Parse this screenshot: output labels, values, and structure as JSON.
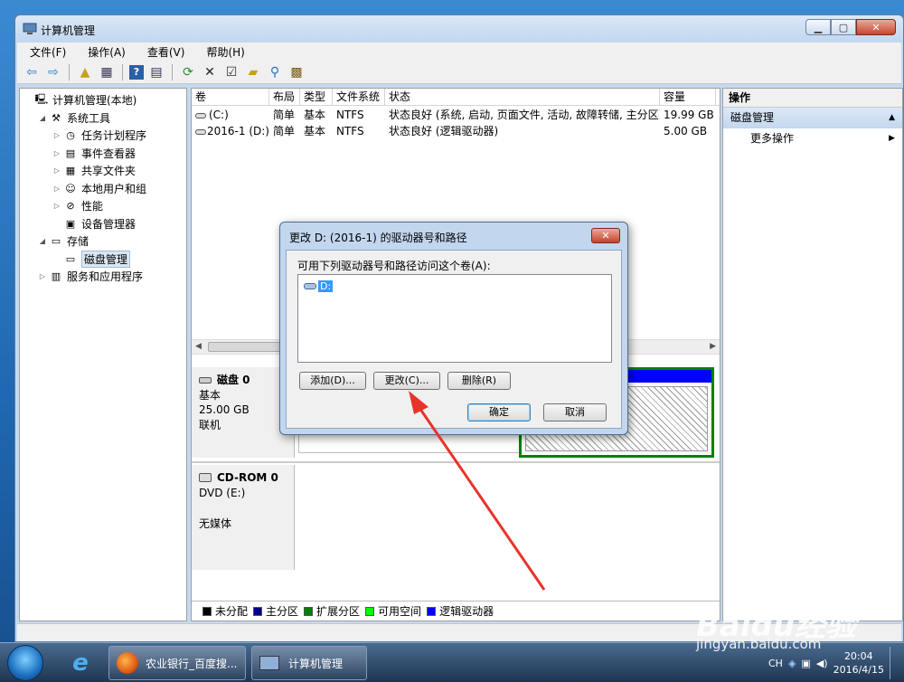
{
  "window": {
    "title": "计算机管理",
    "menus": [
      "文件(F)",
      "操作(A)",
      "查看(V)",
      "帮助(H)"
    ]
  },
  "tree": {
    "items": [
      {
        "label": "计算机管理(本地)",
        "indent": 0,
        "arrow": "",
        "icon": "computer-icon"
      },
      {
        "label": "系统工具",
        "indent": 1,
        "arrow": "◢",
        "icon": "tools-icon"
      },
      {
        "label": "任务计划程序",
        "indent": 2,
        "arrow": "▷",
        "icon": "clock-icon"
      },
      {
        "label": "事件查看器",
        "indent": 2,
        "arrow": "▷",
        "icon": "event-viewer-icon"
      },
      {
        "label": "共享文件夹",
        "indent": 2,
        "arrow": "▷",
        "icon": "shared-folder-icon"
      },
      {
        "label": "本地用户和组",
        "indent": 2,
        "arrow": "▷",
        "icon": "users-icon"
      },
      {
        "label": "性能",
        "indent": 2,
        "arrow": "▷",
        "icon": "performance-icon"
      },
      {
        "label": "设备管理器",
        "indent": 2,
        "arrow": "",
        "icon": "device-manager-icon"
      },
      {
        "label": "存储",
        "indent": 1,
        "arrow": "◢",
        "icon": "storage-icon"
      },
      {
        "label": "磁盘管理",
        "indent": 2,
        "arrow": "",
        "icon": "disk-management-icon",
        "selected": true
      },
      {
        "label": "服务和应用程序",
        "indent": 1,
        "arrow": "▷",
        "icon": "services-icon"
      }
    ]
  },
  "volumes": {
    "headers": [
      "卷",
      "布局",
      "类型",
      "文件系统",
      "状态",
      "容量"
    ],
    "rows": [
      [
        "(C:)",
        "简单",
        "基本",
        "NTFS",
        "状态良好 (系统, 启动, 页面文件, 活动, 故障转储, 主分区)",
        "19.99 GB"
      ],
      [
        "2016-1 (D:)",
        "简单",
        "基本",
        "NTFS",
        "状态良好 (逻辑驱动器)",
        "5.00 GB"
      ]
    ]
  },
  "disks": {
    "disk0": {
      "name": "磁盘 0",
      "type": "基本",
      "size": "25.00 GB",
      "status": "联机"
    },
    "cdrom0": {
      "name": "CD-ROM 0",
      "drive": "DVD (E:)",
      "status": "无媒体"
    },
    "partial_text": ")"
  },
  "legend": [
    {
      "label": "未分配",
      "color": "#000000"
    },
    {
      "label": "主分区",
      "color": "#000080"
    },
    {
      "label": "扩展分区",
      "color": "#008000"
    },
    {
      "label": "可用空间",
      "color": "#00ff00"
    },
    {
      "label": "逻辑驱动器",
      "color": "#0000ff"
    }
  ],
  "actions": {
    "header": "操作",
    "section": "磁盘管理",
    "more": "更多操作"
  },
  "dialog": {
    "title": "更改 D: (2016-1) 的驱动器号和路径",
    "prompt": "可用下列驱动器号和路径访问这个卷(A):",
    "list_item": "D:",
    "add": "添加(D)...",
    "change": "更改(C)...",
    "delete": "删除(R)",
    "ok": "确定",
    "cancel": "取消"
  },
  "taskbar": {
    "items": [
      "农业银行_百度搜...",
      "计算机管理"
    ],
    "lang": "CH",
    "time": "20:04",
    "date": "2016/4/15"
  },
  "watermark": {
    "logo": "Baidu经验",
    "url": "jingyan.baidu.com"
  },
  "colors": {
    "arrow": "#e8332a",
    "selection": "#3399ff",
    "titlebar": "#c5d9f0"
  }
}
